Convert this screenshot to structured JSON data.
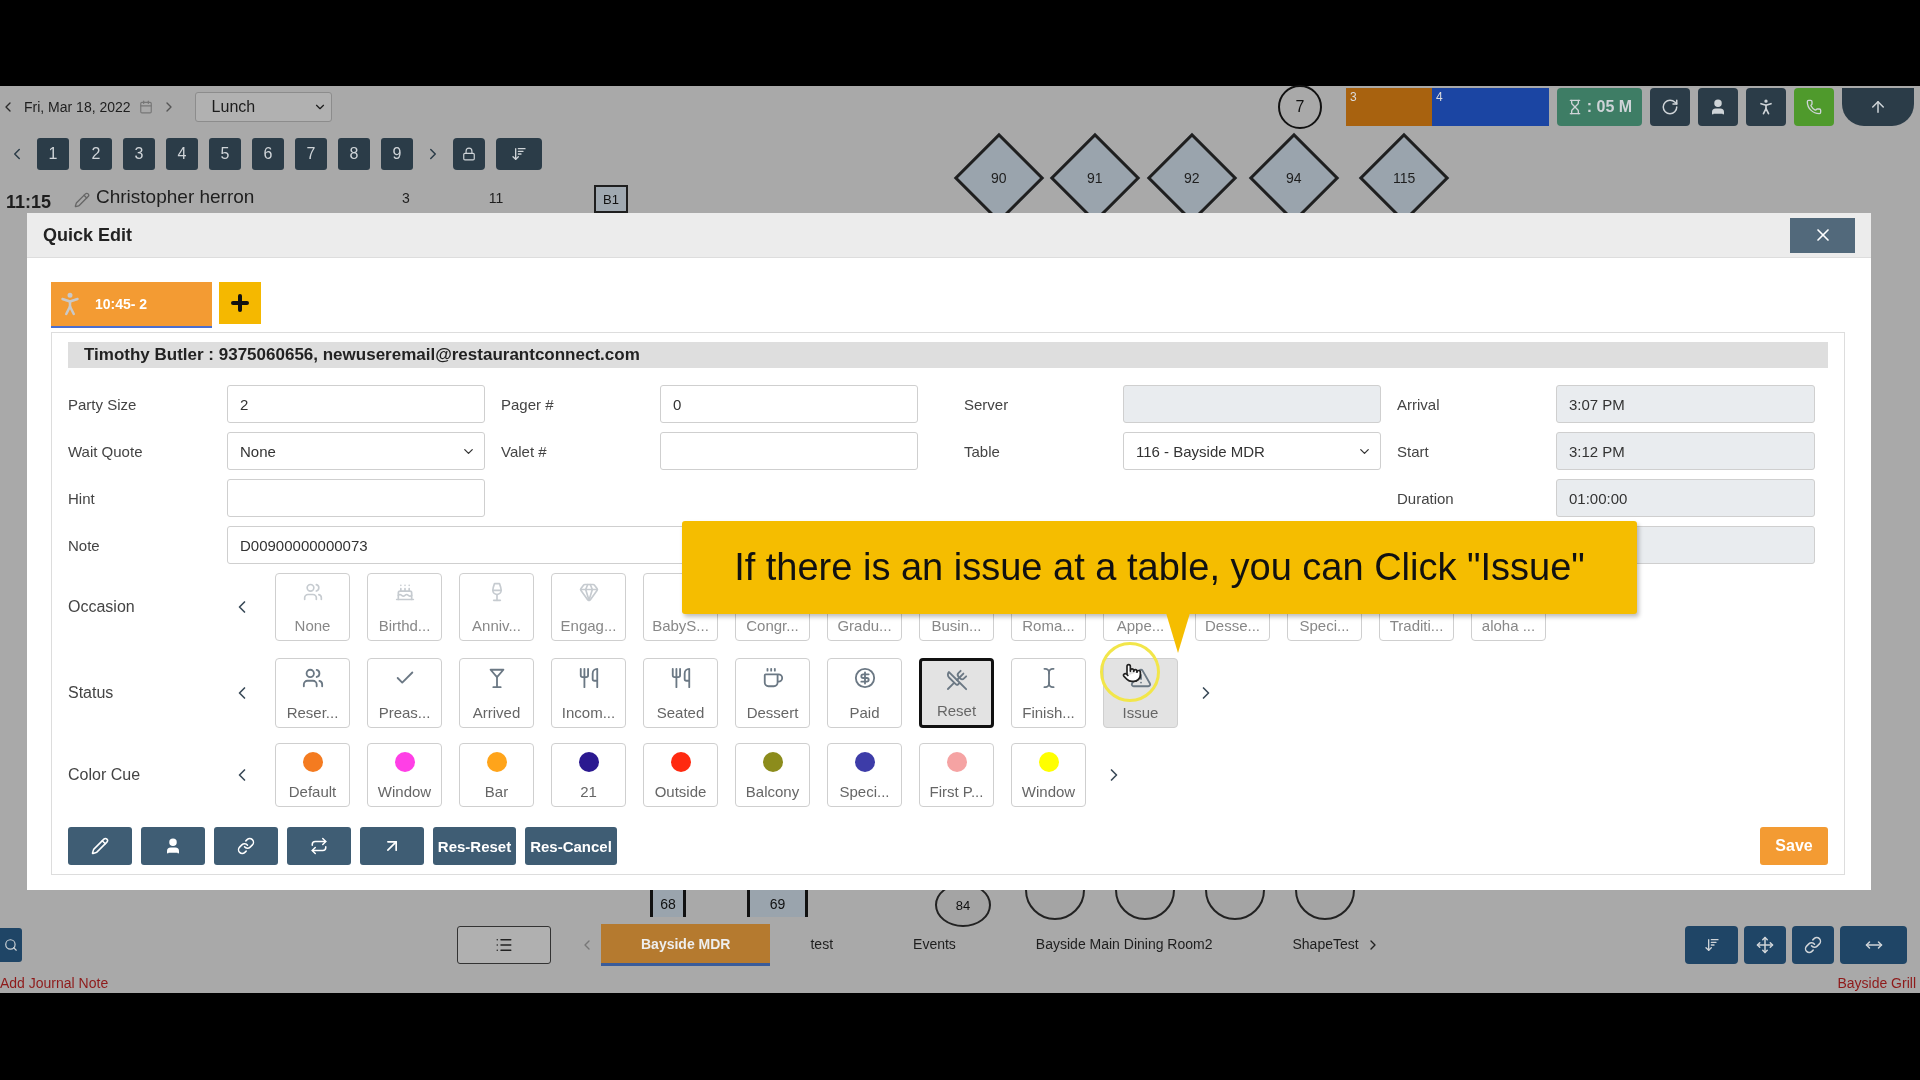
{
  "top_bar": {
    "date": "Fri, Mar 18, 2022",
    "meal": "Lunch",
    "count": "7",
    "segments": [
      {
        "label": "3",
        "color": "#a8620f"
      },
      {
        "label": "4",
        "color": "#1b45a3"
      }
    ],
    "timer": ": 05 M"
  },
  "pages": [
    "1",
    "2",
    "3",
    "4",
    "5",
    "6",
    "7",
    "8",
    "9"
  ],
  "reservation": {
    "time": "11:15",
    "name": "Christopher herron",
    "party": "3",
    "table": "11"
  },
  "floor": {
    "tables": [
      {
        "kind": "box",
        "label": "B1"
      },
      {
        "kind": "diamond",
        "label": "90"
      },
      {
        "kind": "diamond",
        "label": "91"
      },
      {
        "kind": "diamond",
        "label": "92"
      },
      {
        "kind": "diamond",
        "label": "94"
      },
      {
        "kind": "diamond",
        "label": "115"
      },
      {
        "kind": "bar",
        "label": "68"
      },
      {
        "kind": "bar",
        "label": "69"
      },
      {
        "kind": "round",
        "label": "84"
      },
      {
        "kind": "round"
      },
      {
        "kind": "round"
      },
      {
        "kind": "round"
      },
      {
        "kind": "round"
      }
    ]
  },
  "floor_tabs": [
    {
      "label": "Bayside MDR",
      "selected": true
    },
    {
      "label": "test",
      "selected": false
    },
    {
      "label": "Events",
      "selected": false
    },
    {
      "label": "Bayside Main Dining Room2",
      "selected": false
    },
    {
      "label": "ShapeTest",
      "selected": false
    }
  ],
  "footer": {
    "left": "Add Journal Note",
    "right": "Bayside Grill"
  },
  "modal": {
    "title": "Quick Edit",
    "tabs": [
      {
        "label": "10:45- 2",
        "selected": true
      }
    ],
    "guest": "Timothy Butler : 9375060656, newuseremail@restaurantconnect.com",
    "fields": [
      [
        {
          "kind": "input",
          "label": "Party Size",
          "value": "2"
        },
        {
          "kind": "input",
          "label": "Pager #",
          "value": "0"
        },
        {
          "kind": "readonly",
          "label": "Server"
        },
        {
          "kind": "readonly",
          "label": "Arrival",
          "value": "3:07 PM"
        }
      ],
      [
        {
          "kind": "select",
          "label": "Wait Quote",
          "value": "None"
        },
        {
          "kind": "input",
          "label": "Valet #"
        },
        {
          "kind": "select",
          "label": "Table",
          "value": "116 - Bayside MDR"
        },
        {
          "kind": "readonly",
          "label": "Start",
          "value": "3:12 PM"
        }
      ],
      [
        {
          "kind": "input",
          "label": "Hint"
        },
        {
          "kind": "readonly",
          "label": "Duration",
          "value": "01:00:00"
        }
      ],
      [
        {
          "kind": "note",
          "label": "Note",
          "value": "D00900000000073"
        },
        {
          "kind": "readonly"
        }
      ]
    ],
    "occasion": {
      "label": "Occasion",
      "items": [
        {
          "label": "None",
          "selected": false
        },
        {
          "label": "Birthd...",
          "selected": false
        },
        {
          "label": "Anniv...",
          "selected": false
        },
        {
          "label": "Engag...",
          "selected": false
        },
        {
          "label": "BabyS...",
          "selected": false
        },
        {
          "label": "Congr...",
          "selected": false
        },
        {
          "label": "Gradu...",
          "selected": false
        },
        {
          "label": "Busin...",
          "selected": false
        },
        {
          "label": "Roma...",
          "selected": false
        },
        {
          "label": "Appe...",
          "selected": false
        },
        {
          "label": "Desse...",
          "selected": false
        },
        {
          "label": "Speci...",
          "selected": false
        },
        {
          "label": "Traditi...",
          "selected": false
        },
        {
          "label": "aloha ...",
          "selected": false
        }
      ]
    },
    "status": {
      "label": "Status",
      "items": [
        {
          "label": "Reser...",
          "selected": false,
          "highlighted": false
        },
        {
          "label": "Preas...",
          "selected": false,
          "highlighted": false
        },
        {
          "label": "Arrived",
          "selected": false,
          "highlighted": false
        },
        {
          "label": "Incom...",
          "selected": false,
          "highlighted": false
        },
        {
          "label": "Seated",
          "selected": false,
          "highlighted": false
        },
        {
          "label": "Dessert",
          "selected": false,
          "highlighted": false
        },
        {
          "label": "Paid",
          "selected": false,
          "highlighted": false
        },
        {
          "label": "Reset",
          "selected": true,
          "highlighted": false
        },
        {
          "label": "Finish...",
          "selected": false,
          "highlighted": false
        },
        {
          "label": "Issue",
          "selected": false,
          "highlighted": true
        }
      ]
    },
    "color_cue": {
      "label": "Color Cue",
      "items": [
        {
          "label": "Default",
          "color": "#f47b20"
        },
        {
          "label": "Window",
          "color": "#ff3fe6"
        },
        {
          "label": "Bar",
          "color": "#ffa41a"
        },
        {
          "label": "21",
          "color": "#2b1990"
        },
        {
          "label": "Outside",
          "color": "#ff2a10"
        },
        {
          "label": "Balcony",
          "color": "#8c8c1c"
        },
        {
          "label": "Speci...",
          "color": "#3d3ca8"
        },
        {
          "label": "First P...",
          "color": "#f5a3a3"
        },
        {
          "label": "Window",
          "color": "#ffff00"
        }
      ]
    },
    "actions": [
      "Res-Reset",
      "Res-Cancel"
    ],
    "save": "Save",
    "callout": "If there is an issue at a table, you can Click \"Issue\""
  }
}
